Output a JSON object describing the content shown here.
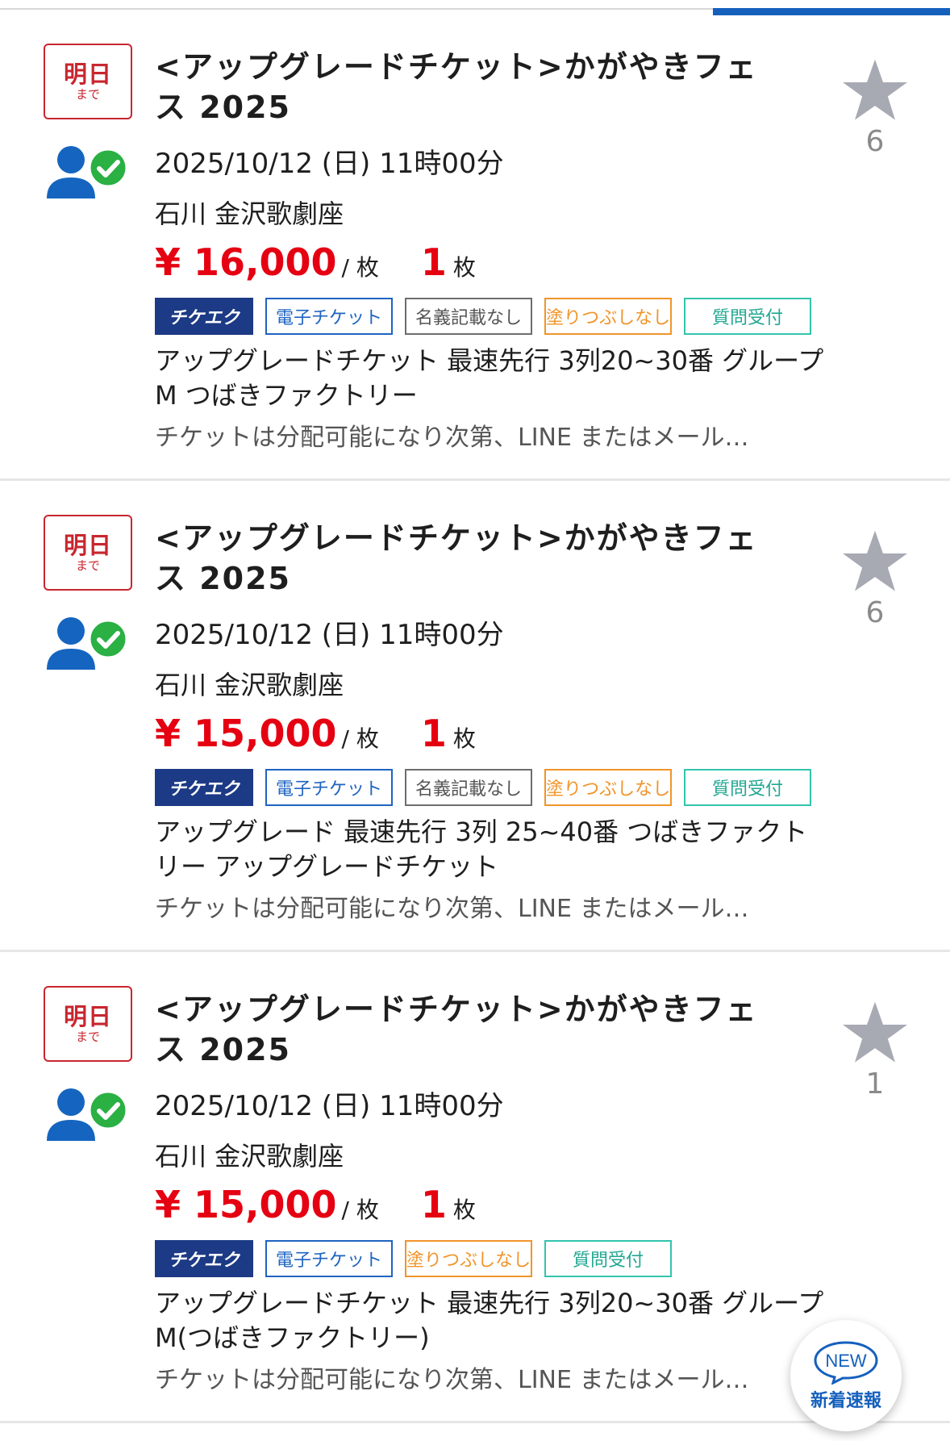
{
  "listings": [
    {
      "deadline_main": "明日",
      "deadline_sub": "まで",
      "title": "<アップグレードチケット>かがやきフェス 2025",
      "date": "2025/10/12 (日) 11時00分",
      "venue": "石川 金沢歌劇座",
      "price": "¥ 16,000",
      "per_unit": "/ 枚",
      "quantity": "1",
      "quantity_unit": "枚",
      "tags": [
        "チケエク",
        "電子チケット",
        "名義記載なし",
        "塗りつぶしなし",
        "質問受付"
      ],
      "description": "アップグレードチケット 最速先行 3列20~30番 グループM つばきファクトリー",
      "note": "チケットは分配可能になり次第、LINE またはメール…",
      "favorite_count": "6"
    },
    {
      "deadline_main": "明日",
      "deadline_sub": "まで",
      "title": "<アップグレードチケット>かがやきフェス 2025",
      "date": "2025/10/12 (日) 11時00分",
      "venue": "石川 金沢歌劇座",
      "price": "¥ 15,000",
      "per_unit": "/ 枚",
      "quantity": "1",
      "quantity_unit": "枚",
      "tags": [
        "チケエク",
        "電子チケット",
        "名義記載なし",
        "塗りつぶしなし",
        "質問受付"
      ],
      "description": "アップグレード 最速先行 3列 25~40番 つばきファクトリー アップグレードチケット",
      "note": "チケットは分配可能になり次第、LINE またはメール…",
      "favorite_count": "6"
    },
    {
      "deadline_main": "明日",
      "deadline_sub": "まで",
      "title": "<アップグレードチケット>かがやきフェス 2025",
      "date": "2025/10/12 (日) 11時00分",
      "venue": "石川 金沢歌劇座",
      "price": "¥ 15,000",
      "per_unit": "/ 枚",
      "quantity": "1",
      "quantity_unit": "枚",
      "tags": [
        "チケエク",
        "電子チケット",
        "塗りつぶしなし",
        "質問受付"
      ],
      "description": " アップグレードチケット 最速先行 3列20~30番 グループM(つばきファクトリー)",
      "note": "チケットは分配可能になり次第、LINE またはメール…",
      "favorite_count": "1"
    }
  ],
  "new_button": {
    "badge": "NEW",
    "label": "新着速報"
  },
  "colors": {
    "price": "#e50012",
    "accent": "#1560bd",
    "deadline": "#c8262f",
    "star": "#a7aab3"
  },
  "icons": [
    "verified-user-icon",
    "star-icon",
    "new-bubble-icon"
  ]
}
